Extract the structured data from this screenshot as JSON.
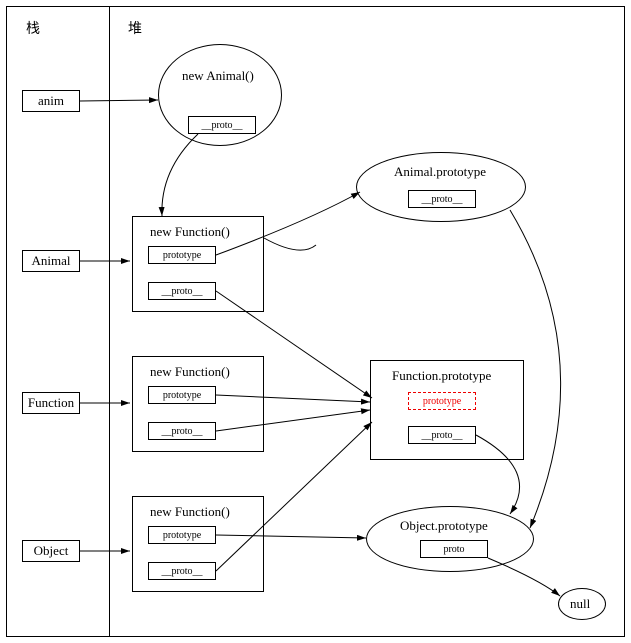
{
  "headings": {
    "stack": "栈",
    "heap": "堆"
  },
  "stack": {
    "anim": "anim",
    "Animal": "Animal",
    "Function": "Function",
    "Object": "Object"
  },
  "heap": {
    "new_animal": {
      "title": "new Animal()",
      "proto": "__proto__"
    },
    "new_function_animal": {
      "title": "new Function()",
      "prototype": "prototype",
      "proto": "__proto__"
    },
    "new_function_function": {
      "title": "new Function()",
      "prototype": "prototype",
      "proto": "__proto__"
    },
    "new_function_object": {
      "title": "new Function()",
      "prototype": "prototype",
      "proto": "__proto__"
    },
    "animal_prototype": {
      "title": "Animal.prototype",
      "proto": "__proto__"
    },
    "function_prototype": {
      "title": "Function.prototype",
      "prototype": "prototype",
      "proto": "__proto__"
    },
    "object_prototype": {
      "title": "Object.prototype",
      "proto": "proto"
    },
    "null": "null"
  }
}
